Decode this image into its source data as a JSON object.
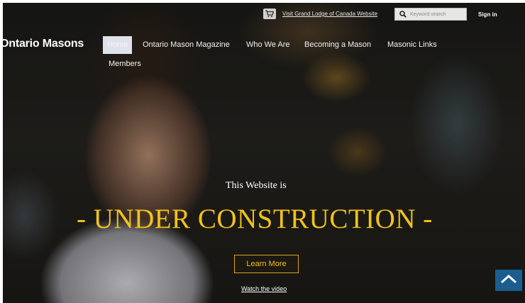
{
  "topbar": {
    "cart_icon": "shopping-cart-icon",
    "grand_lodge_link": "Visit Grand Lodge of Canada Website",
    "search_placeholder": "Keyword search",
    "search_icon": "magnifier-icon",
    "signin_label": "Sign in"
  },
  "brand": {
    "logo_text": "Ontario Masons"
  },
  "nav": {
    "items": [
      {
        "label": "Home",
        "active": true
      },
      {
        "label": "Ontario Mason Magazine"
      },
      {
        "label": "Who We Are"
      },
      {
        "label": "Becoming a Mason"
      },
      {
        "label": "Masonic Links"
      },
      {
        "label": "Members"
      }
    ]
  },
  "hero": {
    "subtitle": "This Website is",
    "headline": "- UNDER CONSTRUCTION -",
    "cta_label": "Learn More",
    "video_link": "Watch the video"
  },
  "scroll_top_icon": "chevron-up-icon",
  "colors": {
    "accent": "#f2c21a",
    "scroll_top_bg": "#1a5d8f"
  }
}
